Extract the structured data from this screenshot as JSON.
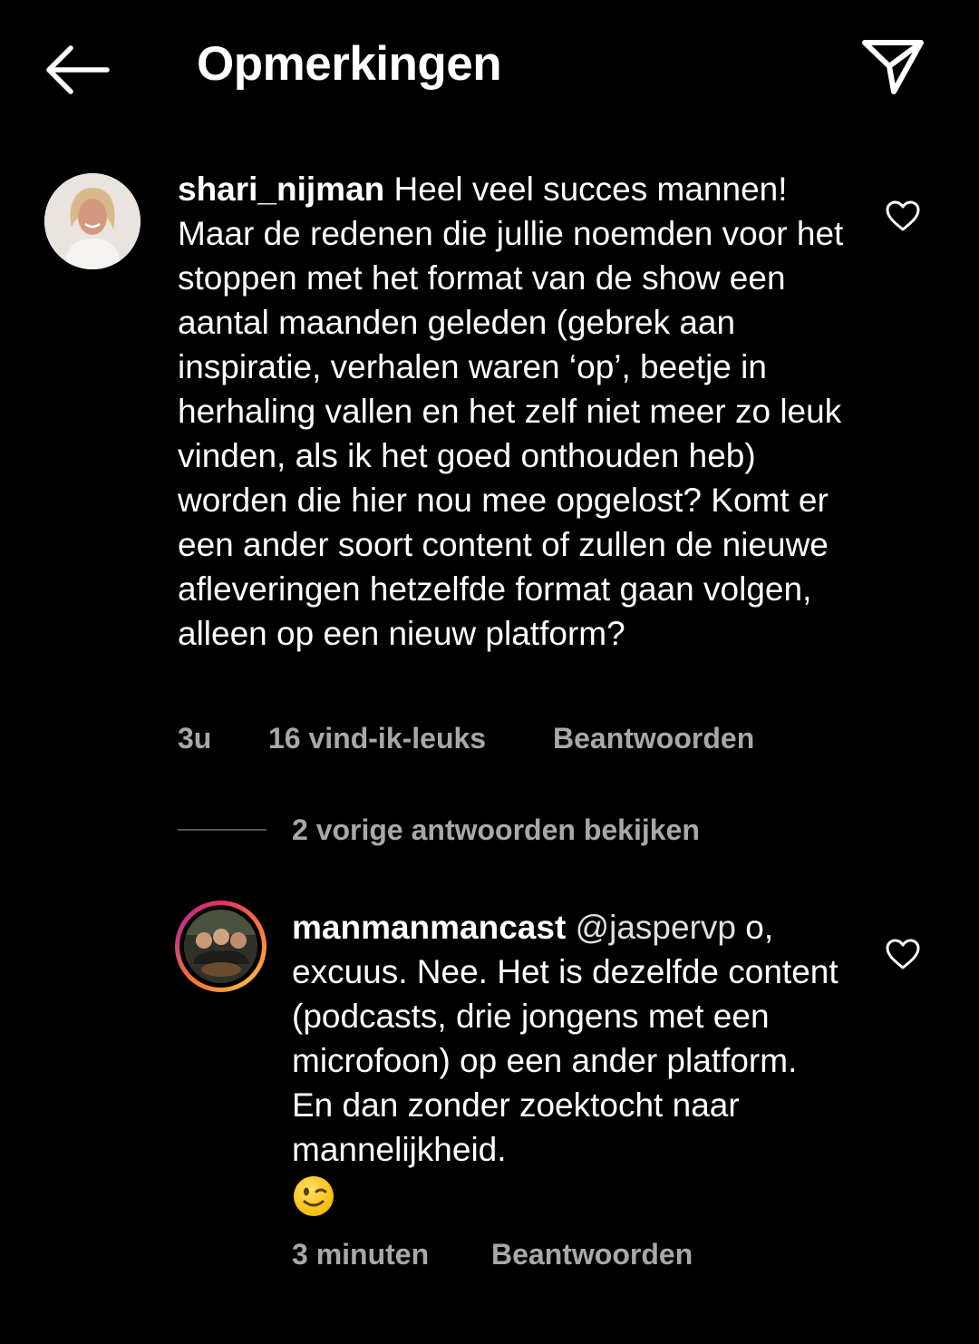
{
  "header": {
    "title": "Opmerkingen",
    "back_icon": "arrow-left-icon",
    "share_icon": "paper-plane-icon"
  },
  "comments": [
    {
      "username": "shari_nijman",
      "text": "Heel veel succes mannen! Maar de redenen die jullie noemden voor het stoppen met het format van de show een aantal maanden geleden (gebrek aan inspiratie, verhalen waren ‘op’, beetje in herhaling vallen en het zelf niet meer zo leuk vinden, als ik het goed onthouden heb) worden die hier nou mee opgelost? Komt er een ander soort content of zullen de nieuwe afleveringen hetzelfde format gaan volgen, alleen op een nieuw platform?",
      "time": "3u",
      "likes": "16 vind-ik-leuks",
      "reply_label": "Beantwoorden"
    }
  ],
  "view_replies": "2 vorige antwoorden bekijken",
  "reply": {
    "username": "manmanmancast",
    "mention": "@jaspervp",
    "text": "o, excuus. Nee. Het is dezelfde content (podcasts, drie jongens met een microfoon) op een ander platform. En dan zonder zoektocht naar mannelijkheid.",
    "emoji": "winking-face",
    "time": "3 minuten",
    "reply_label": "Beantwoorden"
  },
  "colors": {
    "background": "#000000",
    "text": "#ffffff",
    "muted": "#a8a8a8"
  }
}
